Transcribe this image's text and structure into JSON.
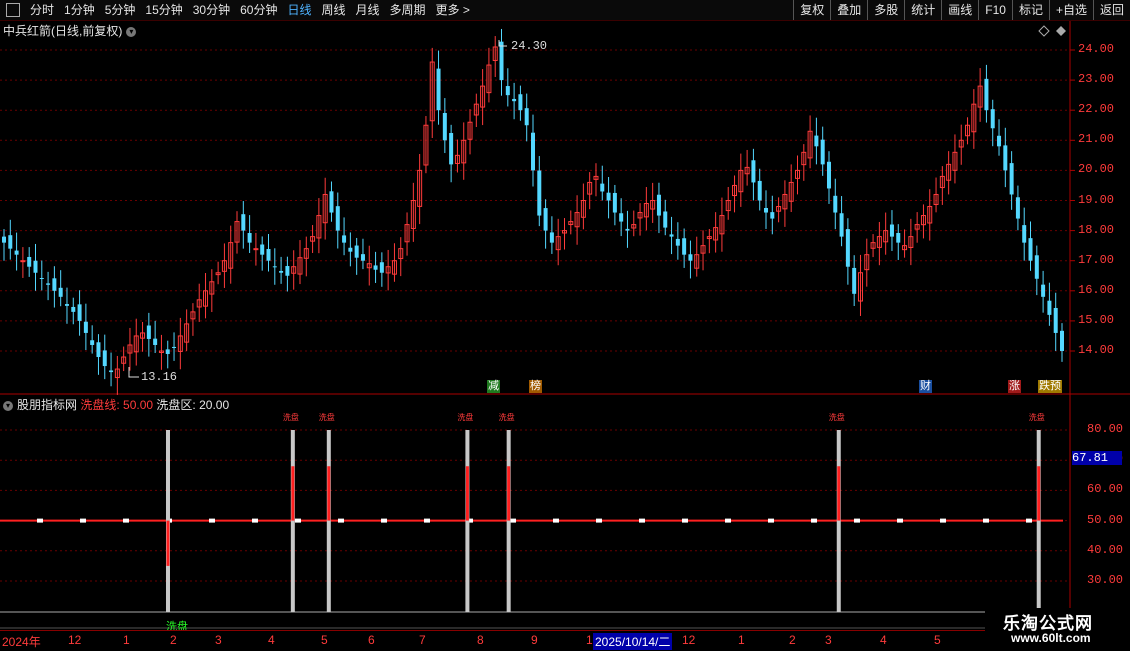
{
  "toolbar": {
    "tabs": [
      "分时",
      "1分钟",
      "5分钟",
      "15分钟",
      "30分钟",
      "60分钟",
      "日线",
      "周线",
      "月线",
      "多周期",
      "更多 >"
    ],
    "active_tab": "日线",
    "right_buttons": [
      "复权",
      "叠加",
      "多股",
      "统计",
      "画线",
      "F10",
      "标记",
      "+自选",
      "返回"
    ]
  },
  "main_title": "中兵红箭(日线,前复权)",
  "price_high_label": "24.30",
  "price_low_label": "13.16",
  "price_axis": [
    "24.00",
    "23.00",
    "22.00",
    "21.00",
    "20.00",
    "19.00",
    "18.00",
    "17.00",
    "16.00",
    "15.00",
    "14.00"
  ],
  "badges": [
    {
      "text": "减",
      "color": "#ffffff",
      "bg": "#1f7a1f"
    },
    {
      "text": "榜",
      "color": "#ffffff",
      "bg": "#a05a00"
    },
    {
      "text": "财",
      "color": "#ffffff",
      "bg": "#1a4fa0"
    },
    {
      "text": "涨",
      "color": "#ffffff",
      "bg": "#a01a1a"
    },
    {
      "text": "跌预",
      "color": "#ffffff",
      "bg": "#a07a00"
    }
  ],
  "indicator": {
    "name": "股朋指标网",
    "line_label": "洗盘线:",
    "line_value": "50.00",
    "zone_label": "洗盘区:",
    "zone_value": "20.00",
    "spike_label": "洗盘",
    "bottom_label": "洗盘",
    "current_value": "67.81"
  },
  "indicator_axis": [
    "80.00",
    "70.00",
    "60.00",
    "50.00",
    "40.00",
    "30.00"
  ],
  "timeline": [
    "2024年",
    "12",
    "1",
    "2",
    "3",
    "4",
    "5",
    "6",
    "7",
    "8",
    "9",
    "1",
    "2025/10/14/二",
    "12",
    "1",
    "2",
    "3",
    "4",
    "5"
  ],
  "watermark": {
    "line1": "乐淘公式网",
    "line2": "www.60lt.com"
  },
  "colors": {
    "up": "#ff3b3b",
    "down": "#54d8ff",
    "wash_line": "#ff2020",
    "bar": "#c8c8c8"
  },
  "chart_data": {
    "type": "candlestick",
    "price_min": 13.16,
    "price_max": 24.3,
    "closes": [
      17.6,
      17.4,
      17.2,
      17.0,
      16.8,
      16.6,
      16.4,
      16.2,
      16.0,
      15.8,
      15.5,
      15.3,
      15.0,
      14.6,
      14.2,
      13.8,
      13.5,
      13.3,
      13.4,
      13.8,
      14.2,
      14.5,
      14.6,
      14.4,
      14.2,
      14.0,
      13.9,
      14.1,
      14.5,
      14.9,
      15.3,
      15.7,
      16.0,
      16.3,
      16.6,
      17.0,
      17.6,
      18.3,
      18.0,
      17.6,
      17.4,
      17.2,
      17.0,
      16.8,
      16.6,
      16.5,
      16.8,
      17.1,
      17.4,
      17.8,
      18.5,
      19.2,
      18.6,
      18.0,
      17.6,
      17.3,
      17.1,
      17.0,
      16.9,
      16.7,
      16.6,
      16.8,
      17.0,
      17.4,
      18.2,
      19.0,
      20.0,
      21.5,
      23.6,
      22.0,
      21.0,
      20.2,
      20.5,
      21.0,
      21.6,
      22.2,
      22.8,
      23.5,
      24.1,
      23.0,
      22.5,
      22.3,
      22.0,
      21.5,
      20.0,
      18.5,
      18.0,
      17.6,
      17.8,
      18.0,
      18.3,
      18.6,
      19.0,
      19.6,
      19.8,
      19.3,
      19.0,
      18.6,
      18.3,
      18.0,
      18.2,
      18.6,
      18.9,
      19.0,
      18.5,
      18.1,
      17.8,
      17.5,
      17.2,
      17.0,
      17.2,
      17.5,
      17.8,
      18.1,
      18.5,
      19.0,
      19.5,
      20.0,
      20.1,
      19.6,
      19.0,
      18.6,
      18.4,
      18.8,
      19.2,
      19.6,
      20.0,
      20.6,
      21.3,
      20.8,
      20.2,
      19.4,
      18.6,
      17.8,
      16.8,
      15.9,
      16.6,
      17.2,
      17.6,
      17.8,
      18.0,
      17.8,
      17.6,
      17.5,
      17.8,
      18.2,
      18.5,
      18.8,
      19.2,
      19.8,
      20.2,
      20.6,
      21.0,
      21.5,
      22.2,
      22.8,
      22.0,
      21.4,
      20.8,
      20.0,
      19.2,
      18.4,
      17.6,
      17.0,
      16.4,
      15.8,
      15.2,
      14.6,
      14.0
    ]
  },
  "spikes": [
    {
      "pos": 0.155,
      "dir": "down",
      "label": ""
    },
    {
      "pos": 0.273,
      "dir": "up",
      "label": "洗盘"
    },
    {
      "pos": 0.307,
      "dir": "up",
      "label": "洗盘"
    },
    {
      "pos": 0.438,
      "dir": "up",
      "label": "洗盘"
    },
    {
      "pos": 0.477,
      "dir": "up",
      "label": "洗盘"
    },
    {
      "pos": 0.789,
      "dir": "up",
      "label": "洗盘"
    },
    {
      "pos": 0.978,
      "dir": "up",
      "label": "洗盘"
    }
  ]
}
